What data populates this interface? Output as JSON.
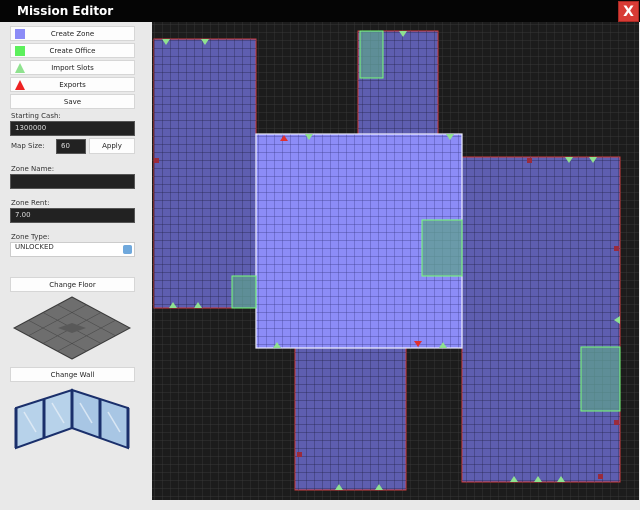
{
  "window": {
    "title": "Mission Editor",
    "close_label": "X"
  },
  "toolbar": {
    "create_zone": "Create Zone",
    "create_office": "Create Office",
    "import_slots": "Import Slots",
    "exports": "Exports",
    "save": "Save"
  },
  "form": {
    "starting_cash_label": "Starting Cash:",
    "starting_cash_value": "1300000",
    "map_size_label": "Map Size:",
    "map_size_value": "60",
    "apply_label": "Apply",
    "zone_name_label": "Zone Name:",
    "zone_name_value": "",
    "zone_rent_label": "Zone Rent:",
    "zone_rent_value": "7.00",
    "zone_type_label": "Zone Type:",
    "zone_type_value": "UNLOCKED"
  },
  "floor": {
    "change_label": "Change Floor"
  },
  "wall": {
    "change_label": "Change Wall"
  },
  "icons": {
    "create_zone": "blue-square-icon",
    "create_office": "green-square-icon",
    "import_slots": "green-triangle-icon",
    "exports": "red-triangle-icon"
  },
  "colors": {
    "zone_fill": "#5e5eb0",
    "zone_border": "#cc3b3b",
    "selected_zone_fill": "#8c8cf7",
    "office_fill": "#5f9f8f",
    "office_border": "#79ff79",
    "slot_marker": "#8fe28f",
    "export_marker": "#e03030"
  }
}
